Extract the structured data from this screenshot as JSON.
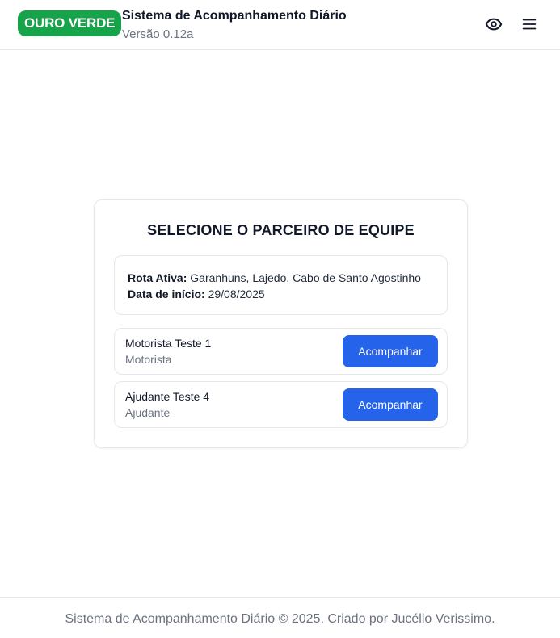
{
  "header": {
    "brand": "OURO VERDE",
    "title": "Sistema de Acompanhamento Diário",
    "version": "Versão 0.12a",
    "icons": {
      "view": "eye-icon",
      "menu": "hamburger-menu-icon"
    }
  },
  "card": {
    "title": "SELECIONE O PARCEIRO DE EQUIPE",
    "route": {
      "active_label": "Rota Ativa:",
      "active_value": "Garanhuns, Lajedo, Cabo de Santo Agostinho",
      "start_label": "Data de início:",
      "start_value": "29/08/2025"
    },
    "members": [
      {
        "name": "Motorista Teste 1",
        "role": "Motorista",
        "action": "Acompanhar"
      },
      {
        "name": "Ajudante Teste 4",
        "role": "Ajudante",
        "action": "Acompanhar"
      }
    ]
  },
  "footer": {
    "text": "Sistema de Acompanhamento Diário © 2025. Criado por Jucélio Verissimo."
  },
  "colors": {
    "brand": "#16a34a",
    "primary_button": "#2563eb",
    "muted_text": "#6b7280",
    "border": "#e5e7eb"
  }
}
